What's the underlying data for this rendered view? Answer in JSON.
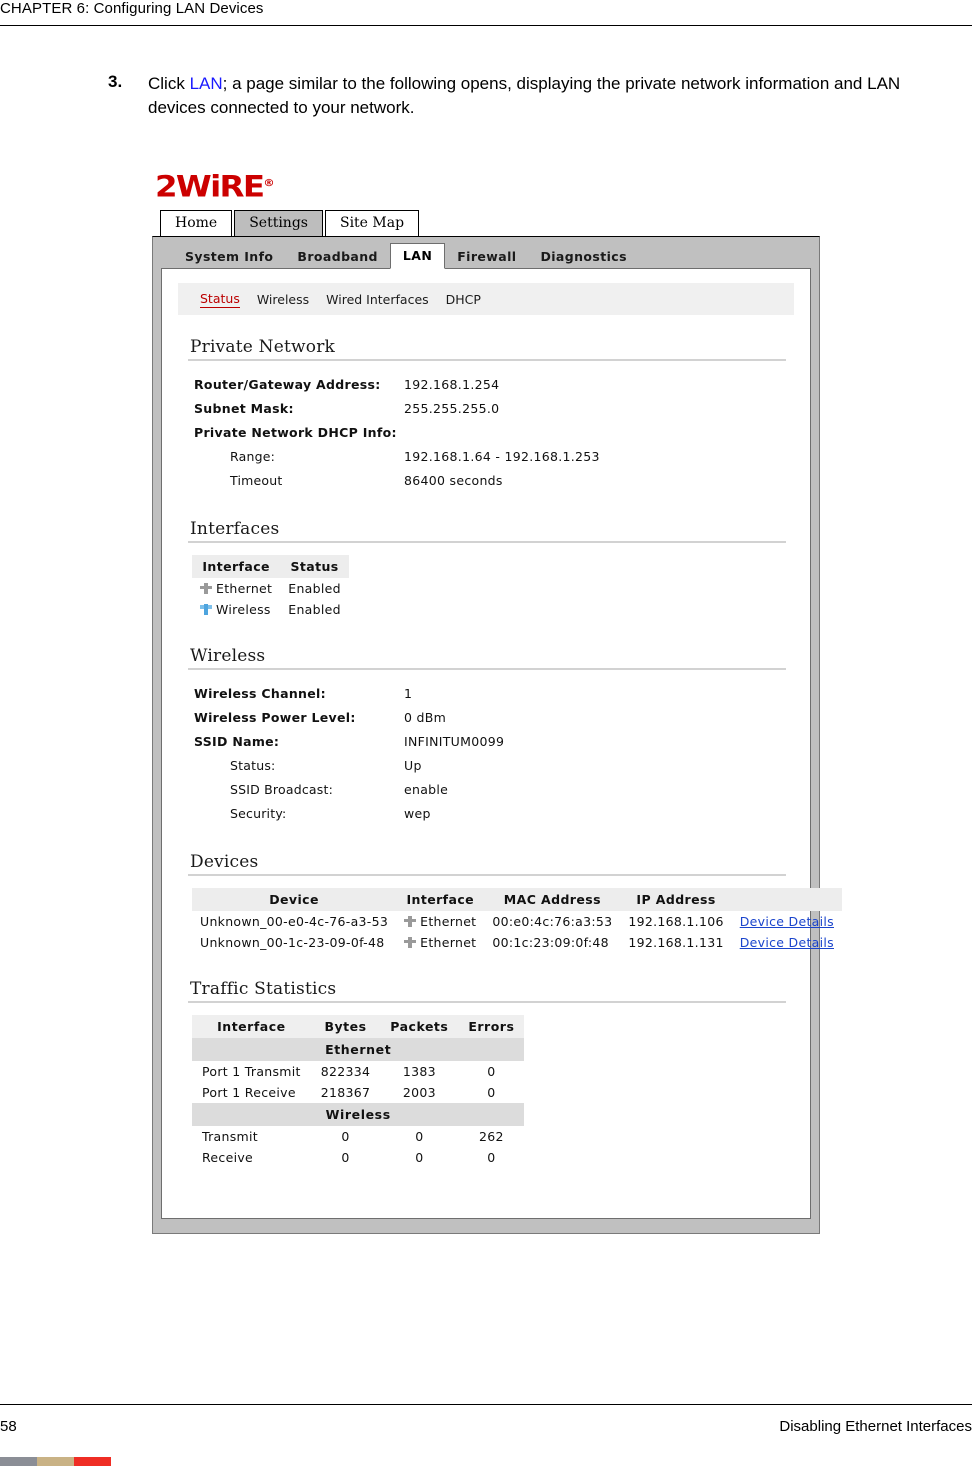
{
  "running_head": "CHAPTER 6: Configuring LAN Devices",
  "step": {
    "number": "3.",
    "before_link": "Click ",
    "link": "LAN",
    "after_link": "; a page similar to the following opens, displaying the private network information and LAN devices connected to your network."
  },
  "screenshot": {
    "logo": {
      "text": "2WiRE",
      "registered": "®",
      "color": "#cc0000"
    },
    "primary_tabs": [
      {
        "label": "Home",
        "active": false
      },
      {
        "label": "Settings",
        "active": true
      },
      {
        "label": "Site Map",
        "active": false
      }
    ],
    "secondary_tabs": [
      {
        "label": "System Info",
        "active": false
      },
      {
        "label": "Broadband",
        "active": false
      },
      {
        "label": "LAN",
        "active": true
      },
      {
        "label": "Firewall",
        "active": false
      },
      {
        "label": "Diagnostics",
        "active": false
      }
    ],
    "sub_nav": [
      {
        "label": "Status",
        "selected": true
      },
      {
        "label": "Wireless",
        "selected": false
      },
      {
        "label": "Wired Interfaces",
        "selected": false
      },
      {
        "label": "DHCP",
        "selected": false
      }
    ],
    "private_network": {
      "title": "Private Network",
      "rows": [
        {
          "key": "Router/Gateway Address:",
          "value": "192.168.1.254",
          "indent": false
        },
        {
          "key": "Subnet Mask:",
          "value": "255.255.255.0",
          "indent": false
        },
        {
          "key": "Private Network DHCP Info:",
          "value": "",
          "indent": false
        },
        {
          "key": "Range:",
          "value": "192.168.1.64 -  192.168.1.253",
          "indent": true
        },
        {
          "key": "Timeout",
          "value": "86400   seconds",
          "indent": true
        }
      ]
    },
    "interfaces": {
      "title": "Interfaces",
      "headers": [
        "Interface",
        "Status"
      ],
      "rows": [
        {
          "icon": "ethernet-icon",
          "interface": "Ethernet",
          "status": "Enabled"
        },
        {
          "icon": "wireless-icon",
          "interface": "Wireless",
          "status": "Enabled"
        }
      ]
    },
    "wireless": {
      "title": "Wireless",
      "rows": [
        {
          "key": "Wireless Channel:",
          "value": "1",
          "indent": false
        },
        {
          "key": "Wireless Power Level:",
          "value": "0 dBm",
          "indent": false
        },
        {
          "key": "SSID Name:",
          "value": "INFINITUM0099",
          "indent": false
        },
        {
          "key": "Status:",
          "value": "Up",
          "indent": true
        },
        {
          "key": "SSID Broadcast:",
          "value": "enable",
          "indent": true
        },
        {
          "key": "Security:",
          "value": "wep",
          "indent": true
        }
      ]
    },
    "devices": {
      "title": "Devices",
      "headers": [
        "Device",
        "Interface",
        "MAC Address",
        "IP Address"
      ],
      "rows": [
        {
          "device": "Unknown_00-e0-4c-76-a3-53",
          "icon": "ethernet-icon",
          "interface": "Ethernet",
          "mac": "00:e0:4c:76:a3:53",
          "ip": "192.168.1.106",
          "link": "Device Details"
        },
        {
          "device": "Unknown_00-1c-23-09-0f-48",
          "icon": "ethernet-icon",
          "interface": "Ethernet",
          "mac": "00:1c:23:09:0f:48",
          "ip": "192.168.1.131",
          "link": "Device Details"
        }
      ]
    },
    "traffic": {
      "title": "Traffic Statistics",
      "headers": [
        "Interface",
        "Bytes",
        "Packets",
        "Errors"
      ],
      "groups": [
        {
          "name": "Ethernet",
          "rows": [
            {
              "label": "Port 1 Transmit",
              "bytes": "822334",
              "packets": "1383",
              "errors": "0"
            },
            {
              "label": "Port 1 Receive",
              "bytes": "218367",
              "packets": "2003",
              "errors": "0"
            }
          ]
        },
        {
          "name": "Wireless",
          "rows": [
            {
              "label": "Transmit",
              "bytes": "0",
              "packets": "0",
              "errors": "262"
            },
            {
              "label": "Receive",
              "bytes": "0",
              "packets": "0",
              "errors": "0"
            }
          ]
        }
      ]
    }
  },
  "footer": {
    "page_number": "58",
    "section_title": "Disabling Ethernet Interfaces",
    "color_bar": [
      "#8b8e96",
      "#c9b285",
      "#ef2d24"
    ]
  }
}
